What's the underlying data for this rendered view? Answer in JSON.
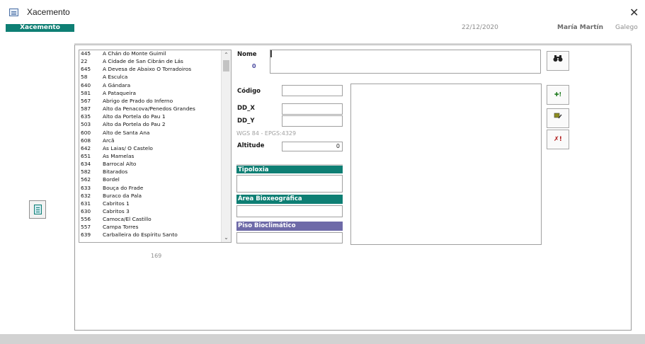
{
  "window": {
    "title": "Xacemento",
    "close_glyph": "✕"
  },
  "header": {
    "form_label": "Xacemento",
    "date": "22/12/2020",
    "user": "María Martín",
    "language": "Galego"
  },
  "list": {
    "rows": [
      {
        "code": "445",
        "name": "A Chán do Monte Guimil"
      },
      {
        "code": "22",
        "name": "A Cidade de San Cibrán de Lás"
      },
      {
        "code": "645",
        "name": "A Devesa de Abaixo O Torradoiros"
      },
      {
        "code": "58",
        "name": "A Esculca"
      },
      {
        "code": "640",
        "name": "A Gándara"
      },
      {
        "code": "581",
        "name": "A Pataqueira"
      },
      {
        "code": "567",
        "name": "Abrigo de Prado do Inferno"
      },
      {
        "code": "587",
        "name": "Alto da Penacova/Penedos Grandes"
      },
      {
        "code": "635",
        "name": "Alto da Portela do Pau 1"
      },
      {
        "code": "503",
        "name": "Alto da Portela do Pau 2"
      },
      {
        "code": "600",
        "name": "Alto de Santa Ana"
      },
      {
        "code": "608",
        "name": "Arcã"
      },
      {
        "code": "642",
        "name": "As Laias/ O Castelo"
      },
      {
        "code": "651",
        "name": "As Mamelas"
      },
      {
        "code": "634",
        "name": "Barrocal Alto"
      },
      {
        "code": "582",
        "name": "Bitarados"
      },
      {
        "code": "562",
        "name": "Bordel"
      },
      {
        "code": "633",
        "name": "Bouça do Frade"
      },
      {
        "code": "632",
        "name": "Buraco da Pala"
      },
      {
        "code": "631",
        "name": "Cabritos 1"
      },
      {
        "code": "630",
        "name": "Cabritos 3"
      },
      {
        "code": "556",
        "name": "Camoca/El Castillo"
      },
      {
        "code": "557",
        "name": "Campa Torres"
      },
      {
        "code": "639",
        "name": "Carballeira do Espíritu Santo"
      }
    ],
    "count": "169",
    "scroll_up": "⌃",
    "scroll_down": "⌄"
  },
  "form": {
    "nome_label": "Nome",
    "nome_id": "0",
    "codigo_label": "Código",
    "ddx_label": "DD_X",
    "ddy_label": "DD_Y",
    "wgs_note": "WGS 84 - EPGS:4329",
    "altitude_label": "Altitude",
    "altitude_value": "0",
    "tipoloxia_label": "Tipoloxia",
    "area_label": "Área Bioxeográfica",
    "piso_label": "Piso Bioclimático"
  },
  "actions": {
    "search_icon": "binoculars-icon",
    "search_glyph": "👓",
    "add_glyph": "✚!",
    "edit_glyph": "✎",
    "delete_glyph": "✗!"
  },
  "colors": {
    "teal": "#0e7f74",
    "purple": "#6e6aa8",
    "title_blue": "#4a6fa5"
  }
}
